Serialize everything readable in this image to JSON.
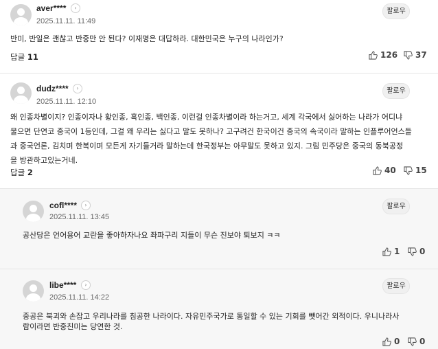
{
  "comments": [
    {
      "username": "aver****",
      "date": "2025.11.11. 11:49",
      "follow_label": "팔로우",
      "lines": [
        "반미, 반일은 괜찮고 반중만 안 된다? 이재명은 대답하라. 대한민국은 누구의 나라인가?"
      ],
      "replies_label": "답글",
      "replies_count": "11",
      "likes": "126",
      "dislikes": "37"
    },
    {
      "username": "dudz****",
      "date": "2025.11.11. 12:10",
      "follow_label": "팔로우",
      "lines": [
        "왜 인종차별이지? 인종이자나 황인종, 흑인종, 백인종, 이런걸 인종차별이라 하는거고, 세계 각국에서 싫어하는 나라가 어디냐",
        "물으면 단연코 중국이 1등인데, 그걸 왜 우리는 싫다고 말도 못하나? 고구려건 한국이건 중국의 속국이라 말하는 인플루어언스들",
        "과 중국언론, 김치며 한복이며 모든게 자기들거라 말하는데 한국정부는 아무말도 못하고 있지. 그림 민주당은 중국의 동북공정",
        "을 방관하고있는거네."
      ],
      "replies_label": "답글",
      "replies_count": "2",
      "likes": "40",
      "dislikes": "15"
    },
    {
      "username": "cofl****",
      "date": "2025.11.11. 13:45",
      "follow_label": "팔로우",
      "lines": [
        "공산당은 언어용어 교란을 좋아하자나요 좌파구리 지들이 무슨 진보야 퇴보지 ㅋㅋ"
      ],
      "likes": "1",
      "dislikes": "0"
    },
    {
      "username": "libe****",
      "date": "2025.11.11. 14:22",
      "follow_label": "팔로우",
      "lines": [
        "중공은 북괴와 손잡고 우리나라를 침공한 나라이다. 자유민주국가로 통일할 수 있는 기회를 뺏어간 외적이다. 우니나라사",
        "람이라면 반중친미는 당연한 것."
      ],
      "likes": "0",
      "dislikes": "0"
    }
  ],
  "icons": {
    "avatar": "default-user-avatar",
    "chevron": "chevron-right-icon",
    "like": "thumbs-up-icon",
    "dislike": "thumbs-down-icon"
  }
}
